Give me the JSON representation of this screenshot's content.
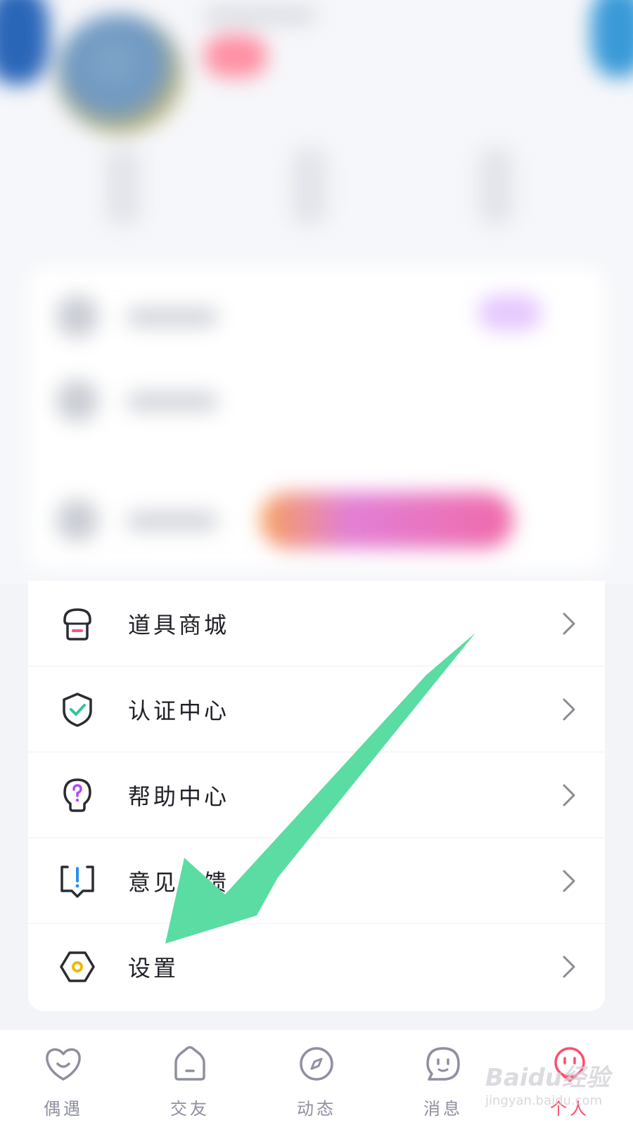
{
  "menu": {
    "items": [
      {
        "label": "道具商城",
        "icon": "shop-icon"
      },
      {
        "label": "认证中心",
        "icon": "shield-check-icon"
      },
      {
        "label": "帮助中心",
        "icon": "help-bulb-icon"
      },
      {
        "label": "意见反馈",
        "icon": "feedback-icon"
      },
      {
        "label": "设置",
        "icon": "settings-icon"
      }
    ]
  },
  "tabs": [
    {
      "label": "偶遇",
      "icon": "heart-face-icon"
    },
    {
      "label": "交友",
      "icon": "house-icon"
    },
    {
      "label": "动态",
      "icon": "compass-icon"
    },
    {
      "label": "消息",
      "icon": "chat-face-icon"
    },
    {
      "label": "个人",
      "icon": "profile-face-icon",
      "active": true
    }
  ],
  "watermark": {
    "main": "Baidu经验",
    "sub": "jingyan.baidu.com"
  },
  "colors": {
    "accent": "#ff4d6d",
    "arrow": "#5bdca2",
    "tab_inactive": "#8e8fa0",
    "icon_stroke": "#2b2b33"
  }
}
